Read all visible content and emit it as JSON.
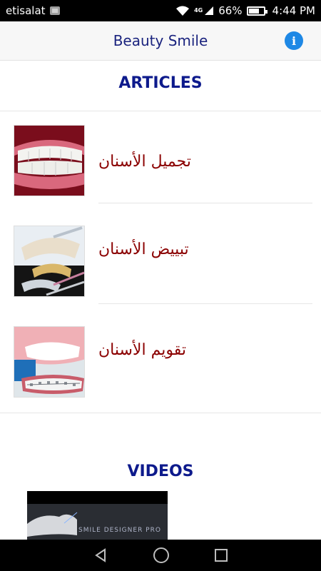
{
  "status_bar": {
    "carrier": "etisalat",
    "network": "4G",
    "battery": "66%",
    "battery_level": 0.66,
    "time": "4:44 PM"
  },
  "app_bar": {
    "title": "Beauty Smile",
    "info_icon": "info-icon"
  },
  "articles": {
    "title": "ARTICLES",
    "items": [
      {
        "label": "تجميل الأسنان",
        "image": "smile-teeth-photo"
      },
      {
        "label": "تبييض الأسنان",
        "image": "whitening-kit-photo"
      },
      {
        "label": "تقويم الأسنان",
        "image": "braces-photo"
      }
    ]
  },
  "videos": {
    "title": "VIDEOS",
    "thumbnail_caption": "SMILE DESIGNER PRO"
  },
  "nav": {
    "back": "back-icon",
    "home": "home-icon",
    "recents": "recents-icon"
  },
  "colors": {
    "header_text": "#1a237e",
    "section_title": "#0d1a8c",
    "article_text": "#8b0000",
    "accent": "#1e88e5"
  }
}
